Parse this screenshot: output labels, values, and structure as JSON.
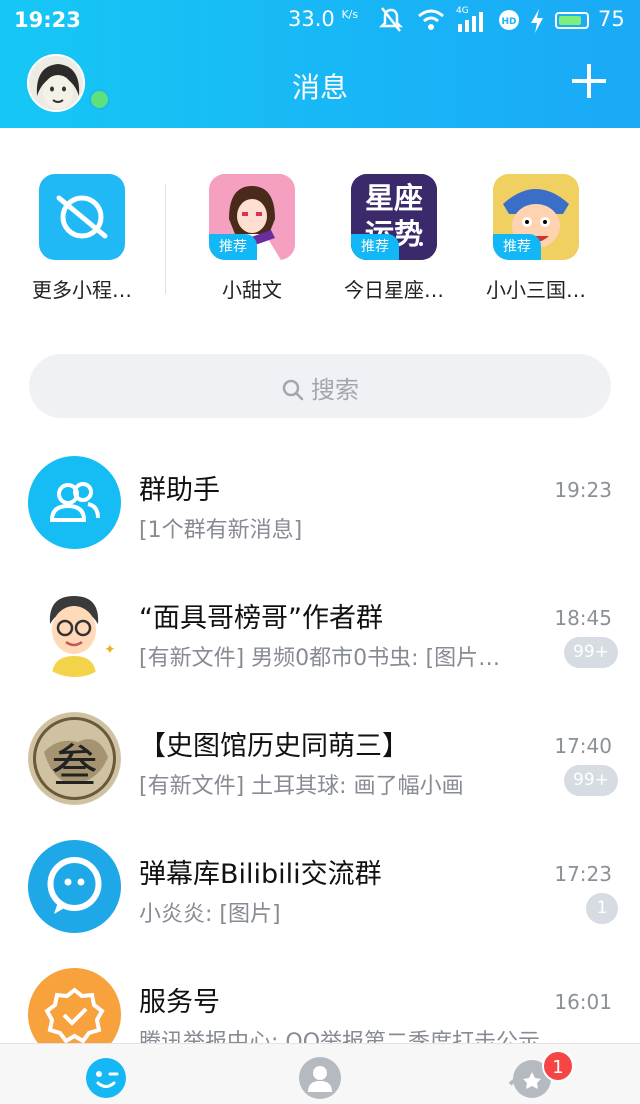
{
  "status_bar": {
    "time": "19:23",
    "speed": "33.0",
    "speed_unit": "K/s",
    "network": "4G",
    "battery": "75"
  },
  "header": {
    "title": "消息"
  },
  "mini_programs": [
    {
      "label": "更多小程…",
      "icon": "planet-icon",
      "recommend": ""
    },
    {
      "label": "小甜文",
      "icon": "anime-girl-icon",
      "recommend": "推荐"
    },
    {
      "label": "今日星座…",
      "icon": "horoscope-icon",
      "recommend": "推荐",
      "icon_text": "星座运势"
    },
    {
      "label": "小小三国…",
      "icon": "three-kingdoms-icon",
      "recommend": "推荐"
    }
  ],
  "search": {
    "placeholder": "搜索"
  },
  "chats": [
    {
      "name": "群助手",
      "preview": "[1个群有新消息]",
      "time": "19:23",
      "count": ""
    },
    {
      "name": "“面具哥榜哥”作者群",
      "preview": "[有新文件] 男频0都市0书虫: [图片…",
      "time": "18:45",
      "count": "99+"
    },
    {
      "name": "【史图馆历史同萌三】",
      "preview": "[有新文件] 土耳其球: 画了幅小画",
      "time": "17:40",
      "count": "99+",
      "avatar_text": "叁"
    },
    {
      "name": "弹幕库Bilibili交流群",
      "preview": "小炎炎: [图片]",
      "time": "17:23",
      "count": "1"
    },
    {
      "name": "服务号",
      "preview": "腾讯举报中心: QQ举报第二季度打击公示",
      "time": "16:01",
      "count": ""
    }
  ],
  "tabbar": {
    "tabs": [
      {
        "icon": "messages-tab-icon"
      },
      {
        "icon": "contacts-tab-icon"
      },
      {
        "icon": "discover-tab-icon"
      }
    ],
    "badge": "1"
  },
  "colors": {
    "accent": "#12b7f5",
    "badge_red": "#f54545"
  }
}
